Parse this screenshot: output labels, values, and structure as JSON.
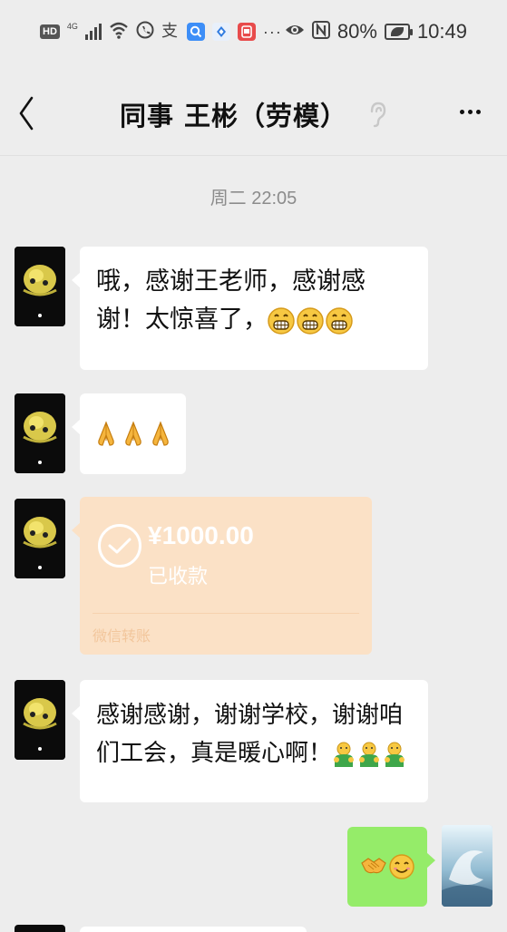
{
  "status_bar": {
    "hd": "HD",
    "network": "4G",
    "battery_percent": "80%",
    "time": "10:49",
    "icons": [
      "hd-icon",
      "signal-icon",
      "wifi-icon",
      "phone-icon",
      "alipay-icon",
      "qq-browser-icon",
      "location-icon",
      "red-app-icon",
      "more-dots-icon",
      "eye-icon",
      "nfc-icon",
      "battery-icon"
    ]
  },
  "header": {
    "title": "同事  王彬（劳模）",
    "icons": [
      "back-icon",
      "ear-icon",
      "more-icon"
    ]
  },
  "timestamp": "周二 22:05",
  "messages": [
    {
      "side": "left",
      "type": "text",
      "text": "哦，感谢王老师，感谢感谢！太惊喜了，",
      "emojis": [
        "grin-emoji",
        "grin-emoji",
        "grin-emoji"
      ]
    },
    {
      "side": "left",
      "type": "emoji",
      "emojis": [
        "pray-emoji",
        "pray-emoji",
        "pray-emoji"
      ]
    },
    {
      "side": "left",
      "type": "transfer",
      "amount": "¥1000.00",
      "status": "已收款",
      "label": "微信转账"
    },
    {
      "side": "left",
      "type": "text",
      "text": "感谢感谢，谢谢学校，谢谢咱们工会，真是暖心啊！",
      "emojis": [
        "hug-emoji",
        "hug-emoji",
        "hug-emoji"
      ]
    },
    {
      "side": "right",
      "type": "emoji",
      "emojis": [
        "handshake-emoji",
        "smile-emoji"
      ]
    }
  ],
  "colors": {
    "background": "#ededed",
    "bubble_left": "#ffffff",
    "bubble_right": "#95ec69",
    "transfer_bg": "#fbe1c6",
    "timestamp": "#8c8c8c"
  }
}
